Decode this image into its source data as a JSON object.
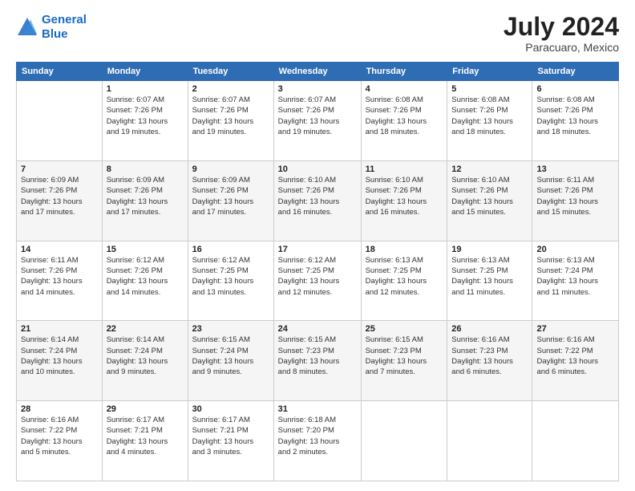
{
  "header": {
    "logo_line1": "General",
    "logo_line2": "Blue",
    "title": "July 2024",
    "subtitle": "Paracuaro, Mexico"
  },
  "days_of_week": [
    "Sunday",
    "Monday",
    "Tuesday",
    "Wednesday",
    "Thursday",
    "Friday",
    "Saturday"
  ],
  "weeks": [
    [
      {
        "day": "",
        "info": ""
      },
      {
        "day": "1",
        "info": "Sunrise: 6:07 AM\nSunset: 7:26 PM\nDaylight: 13 hours\nand 19 minutes."
      },
      {
        "day": "2",
        "info": "Sunrise: 6:07 AM\nSunset: 7:26 PM\nDaylight: 13 hours\nand 19 minutes."
      },
      {
        "day": "3",
        "info": "Sunrise: 6:07 AM\nSunset: 7:26 PM\nDaylight: 13 hours\nand 19 minutes."
      },
      {
        "day": "4",
        "info": "Sunrise: 6:08 AM\nSunset: 7:26 PM\nDaylight: 13 hours\nand 18 minutes."
      },
      {
        "day": "5",
        "info": "Sunrise: 6:08 AM\nSunset: 7:26 PM\nDaylight: 13 hours\nand 18 minutes."
      },
      {
        "day": "6",
        "info": "Sunrise: 6:08 AM\nSunset: 7:26 PM\nDaylight: 13 hours\nand 18 minutes."
      }
    ],
    [
      {
        "day": "7",
        "info": "Sunrise: 6:09 AM\nSunset: 7:26 PM\nDaylight: 13 hours\nand 17 minutes."
      },
      {
        "day": "8",
        "info": "Sunrise: 6:09 AM\nSunset: 7:26 PM\nDaylight: 13 hours\nand 17 minutes."
      },
      {
        "day": "9",
        "info": "Sunrise: 6:09 AM\nSunset: 7:26 PM\nDaylight: 13 hours\nand 17 minutes."
      },
      {
        "day": "10",
        "info": "Sunrise: 6:10 AM\nSunset: 7:26 PM\nDaylight: 13 hours\nand 16 minutes."
      },
      {
        "day": "11",
        "info": "Sunrise: 6:10 AM\nSunset: 7:26 PM\nDaylight: 13 hours\nand 16 minutes."
      },
      {
        "day": "12",
        "info": "Sunrise: 6:10 AM\nSunset: 7:26 PM\nDaylight: 13 hours\nand 15 minutes."
      },
      {
        "day": "13",
        "info": "Sunrise: 6:11 AM\nSunset: 7:26 PM\nDaylight: 13 hours\nand 15 minutes."
      }
    ],
    [
      {
        "day": "14",
        "info": "Sunrise: 6:11 AM\nSunset: 7:26 PM\nDaylight: 13 hours\nand 14 minutes."
      },
      {
        "day": "15",
        "info": "Sunrise: 6:12 AM\nSunset: 7:26 PM\nDaylight: 13 hours\nand 14 minutes."
      },
      {
        "day": "16",
        "info": "Sunrise: 6:12 AM\nSunset: 7:25 PM\nDaylight: 13 hours\nand 13 minutes."
      },
      {
        "day": "17",
        "info": "Sunrise: 6:12 AM\nSunset: 7:25 PM\nDaylight: 13 hours\nand 12 minutes."
      },
      {
        "day": "18",
        "info": "Sunrise: 6:13 AM\nSunset: 7:25 PM\nDaylight: 13 hours\nand 12 minutes."
      },
      {
        "day": "19",
        "info": "Sunrise: 6:13 AM\nSunset: 7:25 PM\nDaylight: 13 hours\nand 11 minutes."
      },
      {
        "day": "20",
        "info": "Sunrise: 6:13 AM\nSunset: 7:24 PM\nDaylight: 13 hours\nand 11 minutes."
      }
    ],
    [
      {
        "day": "21",
        "info": "Sunrise: 6:14 AM\nSunset: 7:24 PM\nDaylight: 13 hours\nand 10 minutes."
      },
      {
        "day": "22",
        "info": "Sunrise: 6:14 AM\nSunset: 7:24 PM\nDaylight: 13 hours\nand 9 minutes."
      },
      {
        "day": "23",
        "info": "Sunrise: 6:15 AM\nSunset: 7:24 PM\nDaylight: 13 hours\nand 9 minutes."
      },
      {
        "day": "24",
        "info": "Sunrise: 6:15 AM\nSunset: 7:23 PM\nDaylight: 13 hours\nand 8 minutes."
      },
      {
        "day": "25",
        "info": "Sunrise: 6:15 AM\nSunset: 7:23 PM\nDaylight: 13 hours\nand 7 minutes."
      },
      {
        "day": "26",
        "info": "Sunrise: 6:16 AM\nSunset: 7:23 PM\nDaylight: 13 hours\nand 6 minutes."
      },
      {
        "day": "27",
        "info": "Sunrise: 6:16 AM\nSunset: 7:22 PM\nDaylight: 13 hours\nand 6 minutes."
      }
    ],
    [
      {
        "day": "28",
        "info": "Sunrise: 6:16 AM\nSunset: 7:22 PM\nDaylight: 13 hours\nand 5 minutes."
      },
      {
        "day": "29",
        "info": "Sunrise: 6:17 AM\nSunset: 7:21 PM\nDaylight: 13 hours\nand 4 minutes."
      },
      {
        "day": "30",
        "info": "Sunrise: 6:17 AM\nSunset: 7:21 PM\nDaylight: 13 hours\nand 3 minutes."
      },
      {
        "day": "31",
        "info": "Sunrise: 6:18 AM\nSunset: 7:20 PM\nDaylight: 13 hours\nand 2 minutes."
      },
      {
        "day": "",
        "info": ""
      },
      {
        "day": "",
        "info": ""
      },
      {
        "day": "",
        "info": ""
      }
    ]
  ]
}
